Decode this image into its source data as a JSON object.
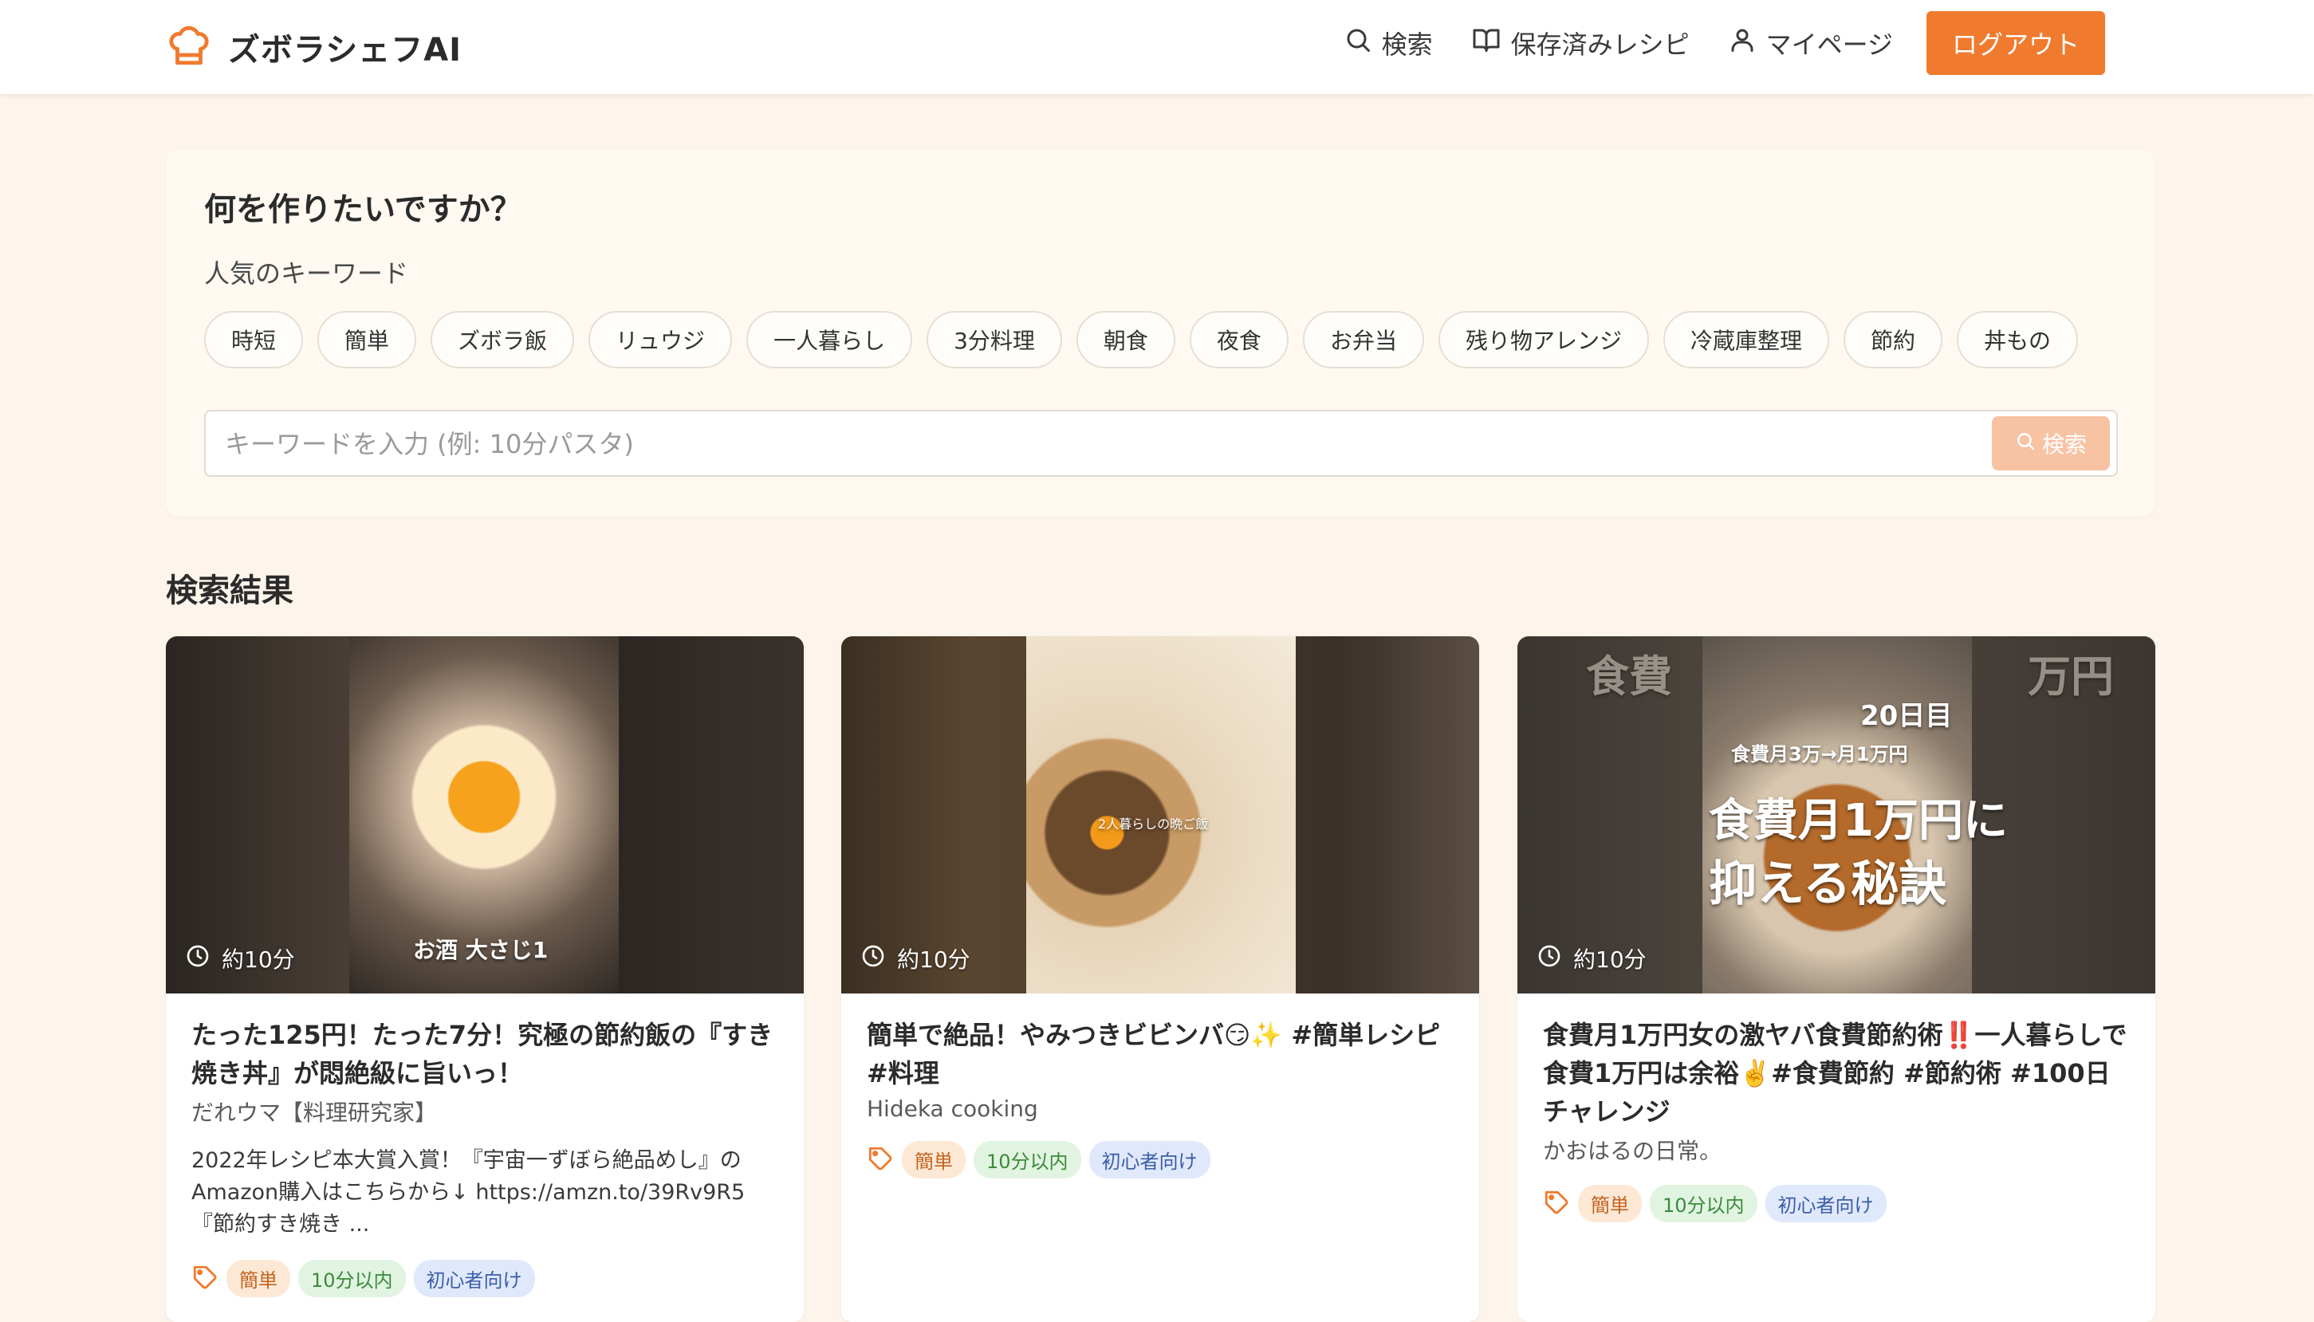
{
  "header": {
    "brand": "ズボラシェフAI",
    "nav": {
      "search": "検索",
      "saved": "保存済みレシピ",
      "mypage": "マイページ",
      "logout": "ログアウト"
    }
  },
  "search_panel": {
    "title": "何を作りたいですか？",
    "popular_label": "人気のキーワード",
    "keywords": [
      "時短",
      "簡単",
      "ズボラ飯",
      "リュウジ",
      "一人暮らし",
      "3分料理",
      "朝食",
      "夜食",
      "お弁当",
      "残り物アレンジ",
      "冷蔵庫整理",
      "節約",
      "丼もの"
    ],
    "input_placeholder": "キーワードを入力 (例: 10分パスタ)",
    "input_value": "",
    "button_label": "検索"
  },
  "results": {
    "title": "検索結果",
    "cards": [
      {
        "time": "約10分",
        "overlay": [
          "お酒 大さじ1"
        ],
        "title": "たった125円！たった7分！究極の節約飯の『すき焼き丼』が悶絶級に旨いっ！",
        "author": "だれウマ【料理研究家】",
        "description": "2022年レシピ本大賞入賞！『宇宙一ずぼら絶品めし』のAmazon購入はこちらから↓ https://amzn.to/39Rv9R5 『節約すき焼き ...",
        "tags": [
          "簡単",
          "10分以内",
          "初心者向け"
        ]
      },
      {
        "time": "約10分",
        "overlay": [
          "2人暮らしの晩ご飯"
        ],
        "title": "簡単で絶品！やみつきビビンバ😏✨ #簡単レシピ #料理",
        "author": "Hideka cooking",
        "description": "",
        "tags": [
          "簡単",
          "10分以内",
          "初心者向け"
        ]
      },
      {
        "time": "約10分",
        "overlay": [
          "食費",
          "万円",
          "20日目",
          "食費月3万→月1万円",
          "食費月1万円に",
          "抑える秘訣"
        ],
        "title": "食費月1万円女の激ヤバ食費節約術‼️一人暮らしで食費1万円は余裕✌️#食費節約 #節約術 #100日チャレンジ",
        "author": "かおはるの日常。",
        "description": "",
        "tags": [
          "簡単",
          "10分以内",
          "初心者向け"
        ]
      }
    ]
  },
  "colors": {
    "accent": "#f07a2e",
    "background": "#fdf5ec",
    "tag_orange": "#fde8d6",
    "tag_green": "#e1f4e1",
    "tag_blue": "#e0e9fb"
  },
  "icons": [
    "chef-hat-icon",
    "search-icon",
    "book-icon",
    "user-icon",
    "clock-icon",
    "tag-icon"
  ]
}
